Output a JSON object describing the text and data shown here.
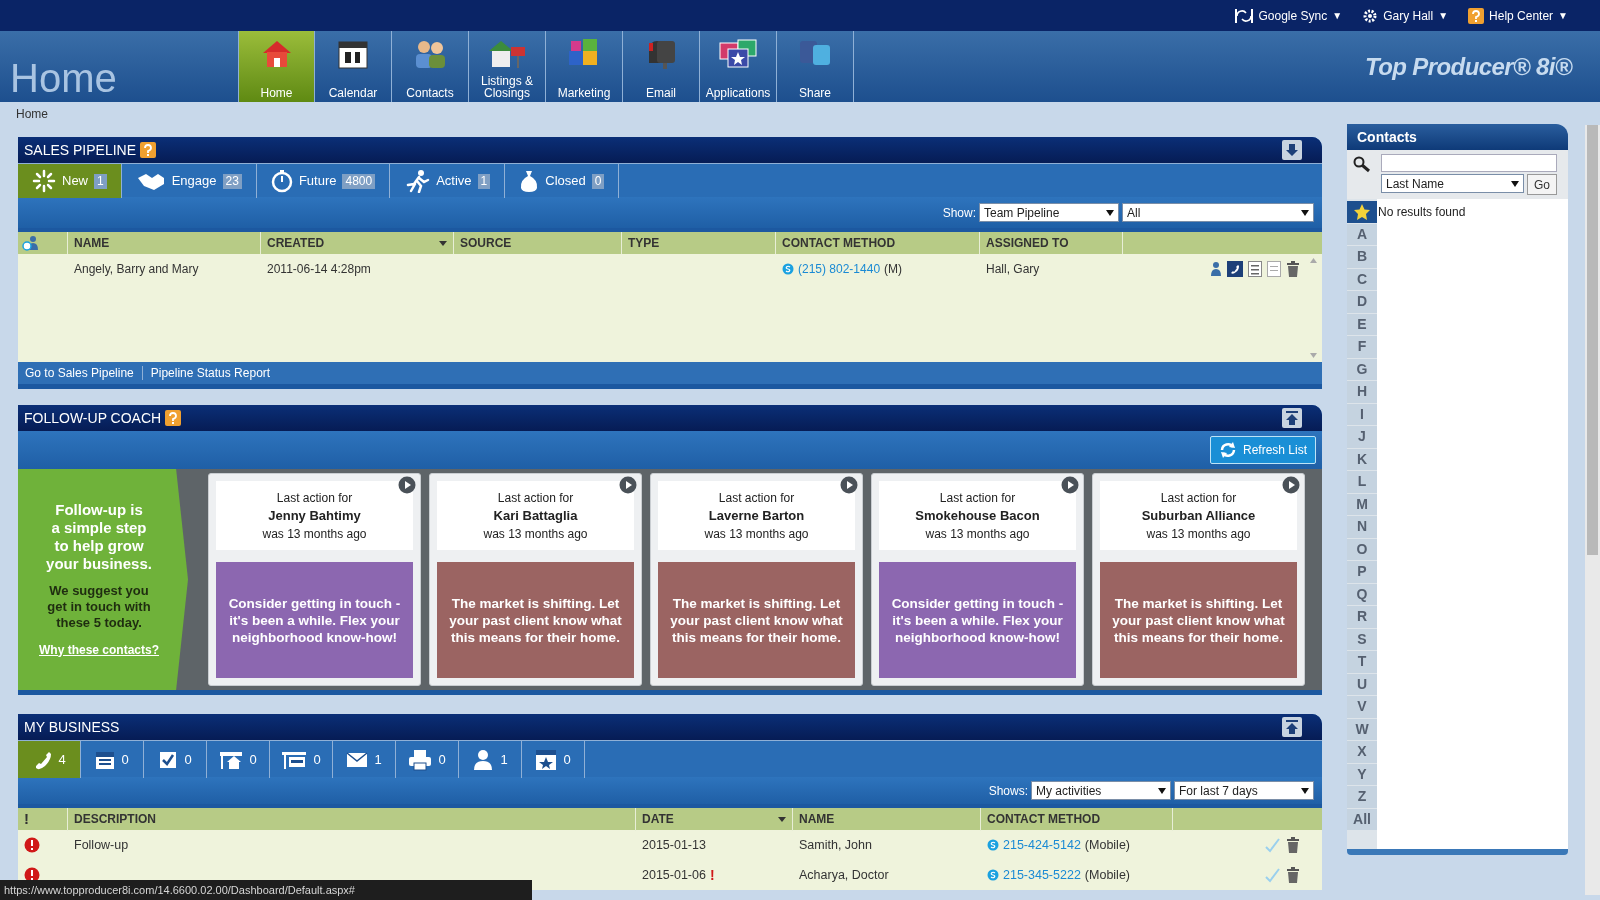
{
  "top_bar": {
    "items": [
      {
        "label": "Google Sync",
        "caret": "▼"
      },
      {
        "label": "Gary Hall",
        "caret": "▼"
      },
      {
        "label": "Help Center",
        "caret": "▼"
      }
    ]
  },
  "page_title": "Home",
  "nav": [
    {
      "label": "Home",
      "selected": true
    },
    {
      "label": "Calendar",
      "selected": false
    },
    {
      "label": "Contacts",
      "selected": false
    },
    {
      "label": "Listings & Closings",
      "selected": false
    },
    {
      "label": "Marketing",
      "selected": false
    },
    {
      "label": "Email",
      "selected": false
    },
    {
      "label": "Applications",
      "selected": false
    },
    {
      "label": "Share",
      "selected": false
    }
  ],
  "logo": "Top Producer® 8i®",
  "breadcrumb": "Home",
  "sales_pipeline": {
    "title": "SALES PIPELINE",
    "tabs": [
      {
        "label": "New",
        "count": "1",
        "selected": true
      },
      {
        "label": "Engage",
        "count": "23",
        "selected": false
      },
      {
        "label": "Future",
        "count": "4800",
        "selected": false
      },
      {
        "label": "Active",
        "count": "1",
        "selected": false
      },
      {
        "label": "Closed",
        "count": "0",
        "selected": false
      }
    ],
    "show_label": "Show:",
    "filters": [
      "Team Pipeline",
      "All"
    ],
    "columns": [
      {
        "label": "NAME",
        "sorted": false
      },
      {
        "label": "CREATED",
        "sorted": true
      },
      {
        "label": "SOURCE",
        "sorted": false
      },
      {
        "label": "TYPE",
        "sorted": false
      },
      {
        "label": "CONTACT METHOD",
        "sorted": false
      },
      {
        "label": "ASSIGNED TO",
        "sorted": false
      }
    ],
    "rows": [
      {
        "name": "Angely, Barry and Mary",
        "created": "2011-06-14 4:28pm",
        "phone": "(215) 802-1440",
        "phone_type": "(M)",
        "assigned_to": "Hall, Gary"
      }
    ],
    "footer_links": [
      "Go to Sales Pipeline",
      "Pipeline Status Report"
    ]
  },
  "follow_up_coach": {
    "title": "FOLLOW-UP COACH",
    "refresh_button": "Refresh List",
    "intro": {
      "headline": "Follow-up is a simple step to help grow your business.",
      "text": "We suggest you get in touch with these 5 today.",
      "link": "Why these contacts?"
    },
    "cards": [
      {
        "prefix": "Last action for",
        "name": "Jenny Bahtimy",
        "ago": "was 13 months ago",
        "message": "Consider getting in touch - it's been a while. Flex your neighborhood know-how!",
        "color": "#8c67b0"
      },
      {
        "prefix": "Last action for",
        "name": "Kari Battaglia",
        "ago": "was 13 months ago",
        "message": "The market is shifting. Let your past client know what this means for their home.",
        "color": "#9b6462"
      },
      {
        "prefix": "Last action for",
        "name": "Laverne Barton",
        "ago": "was 13 months ago",
        "message": "The market is shifting. Let your past client know what this means for their home.",
        "color": "#9b6462"
      },
      {
        "prefix": "Last action for",
        "name": "Smokehouse Bacon",
        "ago": "was 13 months ago",
        "message": "Consider getting in touch - it's been a while. Flex your neighborhood know-how!",
        "color": "#8c67b0"
      },
      {
        "prefix": "Last action for",
        "name": "Suburban Alliance",
        "ago": "was 13 months ago",
        "message": "The market is shifting. Let your past client know what this means for their home.",
        "color": "#9b6462"
      }
    ]
  },
  "my_business": {
    "title": "MY BUSINESS",
    "tabs": [
      {
        "count": "4",
        "selected": true
      },
      {
        "count": "0",
        "selected": false
      },
      {
        "count": "0",
        "selected": false
      },
      {
        "count": "0",
        "selected": false
      },
      {
        "count": "0",
        "selected": false
      },
      {
        "count": "1",
        "selected": false
      },
      {
        "count": "0",
        "selected": false
      },
      {
        "count": "1",
        "selected": false
      },
      {
        "count": "0",
        "selected": false
      }
    ],
    "shows_label": "Shows:",
    "filters": [
      "My activities",
      "For last 7 days"
    ],
    "columns": [
      {
        "label": "!",
        "sorted": false
      },
      {
        "label": "DESCRIPTION",
        "sorted": false
      },
      {
        "label": "DATE",
        "sorted": true
      },
      {
        "label": "NAME",
        "sorted": false
      },
      {
        "label": "CONTACT METHOD",
        "sorted": false
      }
    ],
    "rows": [
      {
        "overdue": true,
        "description": "Follow-up",
        "date": "2015-01-13",
        "name": "Samith, John",
        "phone": "215-424-5142",
        "phone_type": "(Mobile)"
      },
      {
        "overdue": true,
        "date": "2015-01-06",
        "date_flag": "!",
        "name": "Acharya, Doctor",
        "phone": "215-345-5222",
        "phone_type": "(Mobile)"
      }
    ]
  },
  "contacts": {
    "title": "Contacts",
    "search_by": "Last Name",
    "go_button": "Go",
    "message": "No results found",
    "letters": [
      {
        "kind": "star",
        "selected": true
      },
      {
        "kind": "letter",
        "label": "A",
        "selected": false
      },
      {
        "kind": "letter",
        "label": "B",
        "selected": false
      },
      {
        "kind": "letter",
        "label": "C",
        "selected": false
      },
      {
        "kind": "letter",
        "label": "D",
        "selected": false
      },
      {
        "kind": "letter",
        "label": "E",
        "selected": false
      },
      {
        "kind": "letter",
        "label": "F",
        "selected": false
      },
      {
        "kind": "letter",
        "label": "G",
        "selected": false
      },
      {
        "kind": "letter",
        "label": "H",
        "selected": false
      },
      {
        "kind": "letter",
        "label": "I",
        "selected": false
      },
      {
        "kind": "letter",
        "label": "J",
        "selected": false
      },
      {
        "kind": "letter",
        "label": "K",
        "selected": false
      },
      {
        "kind": "letter",
        "label": "L",
        "selected": false
      },
      {
        "kind": "letter",
        "label": "M",
        "selected": false
      },
      {
        "kind": "letter",
        "label": "N",
        "selected": false
      },
      {
        "kind": "letter",
        "label": "O",
        "selected": false
      },
      {
        "kind": "letter",
        "label": "P",
        "selected": false
      },
      {
        "kind": "letter",
        "label": "Q",
        "selected": false
      },
      {
        "kind": "letter",
        "label": "R",
        "selected": false
      },
      {
        "kind": "letter",
        "label": "S",
        "selected": false
      },
      {
        "kind": "letter",
        "label": "T",
        "selected": false
      },
      {
        "kind": "letter",
        "label": "U",
        "selected": false
      },
      {
        "kind": "letter",
        "label": "V",
        "selected": false
      },
      {
        "kind": "letter",
        "label": "W",
        "selected": false
      },
      {
        "kind": "letter",
        "label": "X",
        "selected": false
      },
      {
        "kind": "letter",
        "label": "Y",
        "selected": false
      },
      {
        "kind": "letter",
        "label": "Z",
        "selected": false
      },
      {
        "kind": "letter",
        "label": "All",
        "selected": false
      }
    ]
  },
  "status_bar": {
    "url": "https://www.topproducer8i.com/14.6600.02.00/Dashboard/Default.aspx#"
  }
}
